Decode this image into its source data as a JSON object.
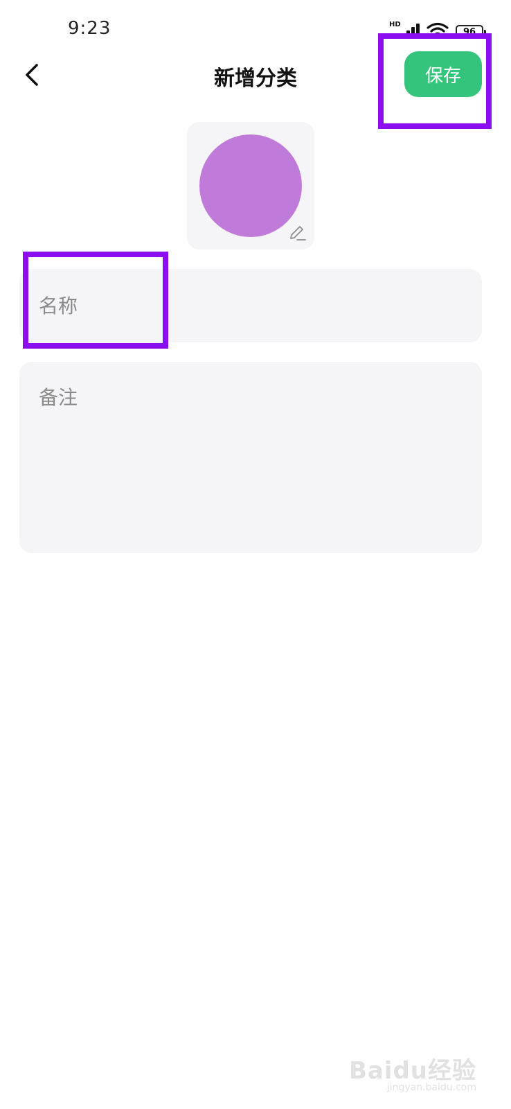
{
  "status_bar": {
    "time": "9:23",
    "network_label": "HD",
    "battery_level": "96",
    "icons": [
      "signal-icon",
      "wifi-icon",
      "battery-icon"
    ]
  },
  "header": {
    "title": "新增分类",
    "back_icon": "chevron-left-icon",
    "save_label": "保存"
  },
  "icon_picker": {
    "color": "#c07ad9",
    "edit_icon": "pencil-icon"
  },
  "form": {
    "name_placeholder": "名称",
    "name_value": "",
    "note_placeholder": "备注",
    "note_value": ""
  },
  "watermark": {
    "main": "Baidu经验",
    "sub": "jingyan.baidu.com"
  },
  "colors": {
    "accent": "#34c47c",
    "highlight": "#8a0ef0",
    "field_background": "#f5f4f6"
  }
}
